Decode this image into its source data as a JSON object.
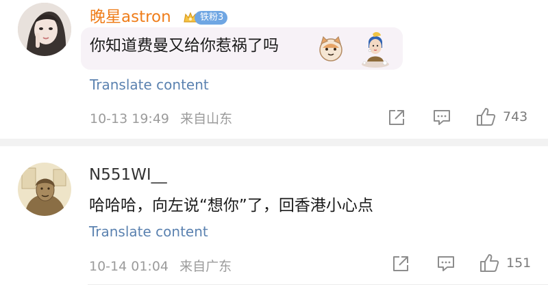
{
  "comments": [
    {
      "username": "晚星astron",
      "badge_label": "铁粉3",
      "text": "你知道费曼又给你惹祸了吗",
      "translate_label": "Translate content",
      "timestamp": "10-13 19:49",
      "location": "来自山东",
      "like_count": "743",
      "icons": [
        "share-icon",
        "comment-icon",
        "like-icon"
      ]
    },
    {
      "username": "N551WI__",
      "text": "哈哈哈，向左说“想你”了，回香港小心点",
      "translate_label": "Translate content",
      "timestamp": "10-14 01:04",
      "location": "来自广东",
      "like_count": "151",
      "icons": [
        "share-icon",
        "comment-icon",
        "like-icon"
      ]
    }
  ],
  "colors": {
    "username_highlight": "#ef7d1a",
    "link": "#5b82b0",
    "meta": "#9b9b9b",
    "badge": "#6fa6e3"
  }
}
